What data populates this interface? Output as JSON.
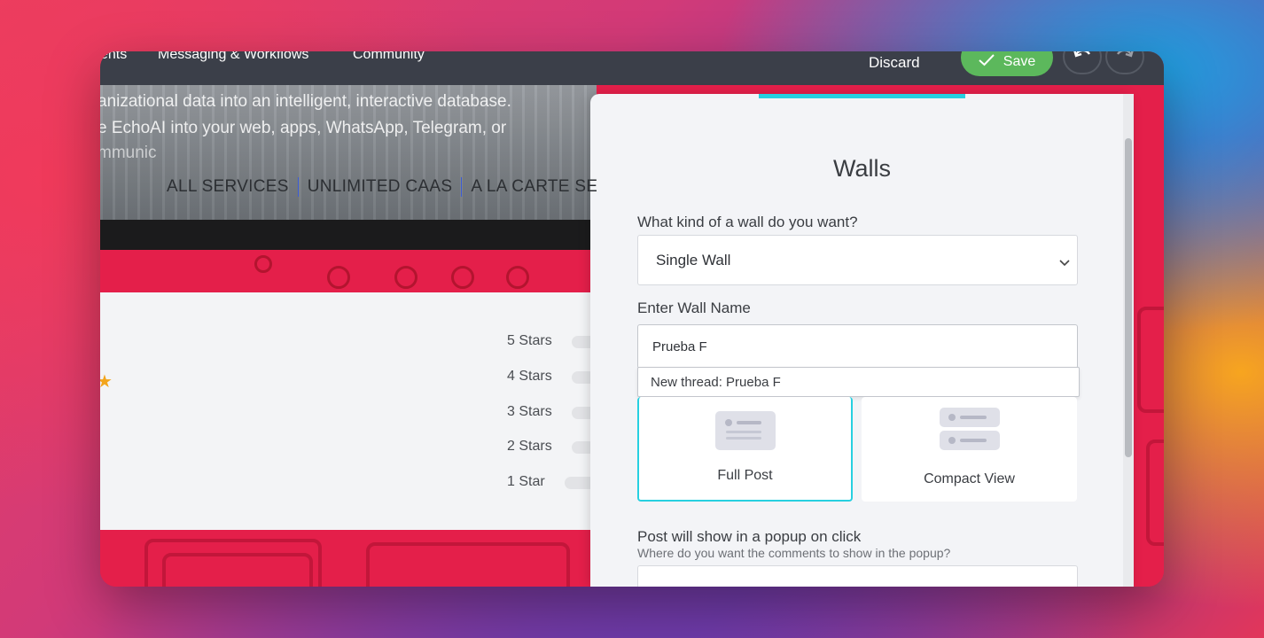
{
  "topbar": {
    "nav": [
      "ents",
      "Messaging & Workflows",
      "Community"
    ],
    "discard_label": "Discard",
    "save_label": "Save",
    "undo_icon": "undo-icon",
    "redo_icon": "redo-icon"
  },
  "hero": {
    "line1": "anizational data into an intelligent, interactive database.",
    "line2": "e EchoAI into your web, apps, WhatsApp, Telegram, or",
    "line3": "mmunic",
    "services": [
      "ALL SERVICES",
      "UNLIMITED CAAS",
      "A LA CARTE SERV"
    ]
  },
  "ratings": {
    "rows": [
      "5 Stars",
      "4 Stars",
      "3 Stars",
      "2 Stars",
      "1 Star"
    ]
  },
  "panel": {
    "title": "Walls",
    "wall_type_label": "What kind of a wall do you want?",
    "wall_type_value": "Single Wall",
    "wall_name_label": "Enter Wall Name",
    "wall_name_value": "Prueba F",
    "suggestion": "New thread: Prueba F",
    "views": {
      "full_post": "Full Post",
      "compact": "Compact View",
      "selected": "Full Post"
    },
    "popup_label": "Post will show in a popup on click",
    "popup_sublabel": "Where do you want the comments to show in the popup?",
    "accent_color": "#27d0e0",
    "save_color": "#5cb85c"
  }
}
